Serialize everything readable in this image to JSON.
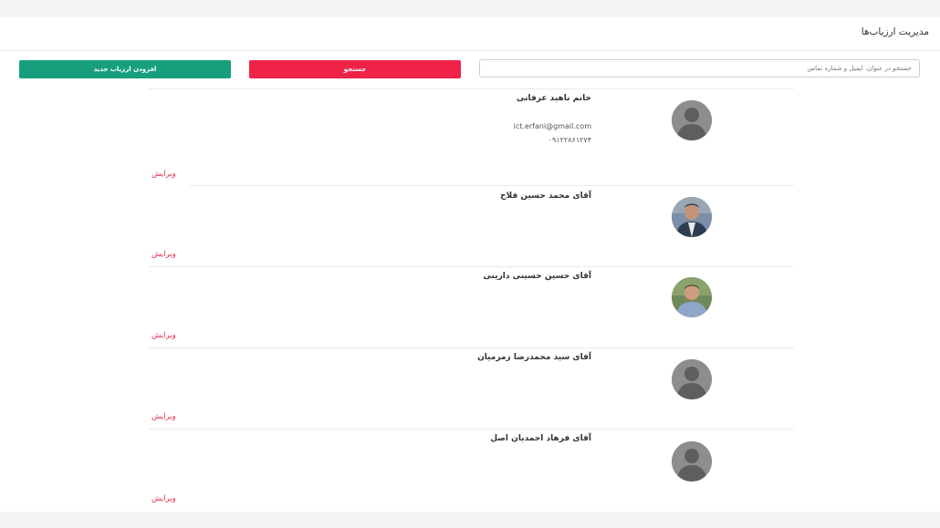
{
  "page": {
    "title": "مدیریت ارزیاب‌ها"
  },
  "search": {
    "placeholder": "جستجو در عنوان، ایمیل و شماره تماس",
    "value": "",
    "button_label": "جستجو"
  },
  "toolbar": {
    "add_label": "افزودن ارزیاب جدید"
  },
  "colors": {
    "search_button": "#ee2347",
    "add_button": "#179f7d",
    "edit_link": "#e0314f"
  },
  "evaluators": [
    {
      "name": "خانم ناهید عرفانی",
      "email": "ict.erfani@gmail.com",
      "phone": "۰۹۱۲۲۸۶۱۲۷۴",
      "avatar": "default-avatar-icon",
      "edit_label": "ویرایش"
    },
    {
      "name": "آقای محمد حسین فلاح",
      "email": "",
      "phone": "",
      "avatar": "profile-photo",
      "edit_label": "ویرایش"
    },
    {
      "name": "آقای حسین حسینی دارینی",
      "email": "",
      "phone": "",
      "avatar": "profile-photo",
      "edit_label": "ویرایش"
    },
    {
      "name": "آقای سید محمدرضا زمزمیان",
      "email": "",
      "phone": "",
      "avatar": "default-avatar-icon",
      "edit_label": "ویرایش"
    },
    {
      "name": "آقای فرهاد احمدیان اصل",
      "email": "",
      "phone": "",
      "avatar": "default-avatar-icon",
      "edit_label": "ویرایش"
    }
  ]
}
